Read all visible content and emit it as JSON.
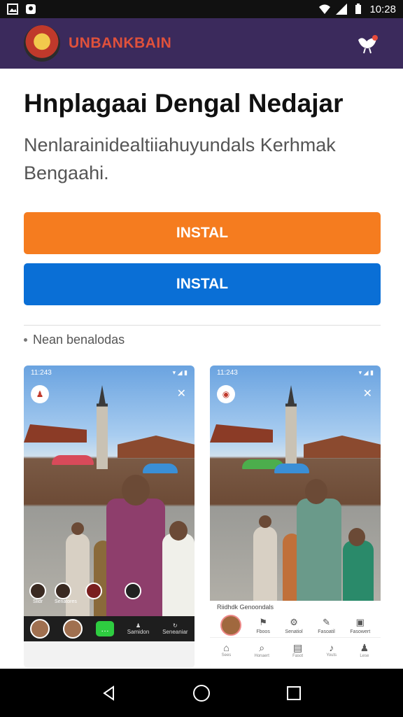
{
  "status_bar": {
    "time": "10:28",
    "notification_icons": [
      "gallery-icon",
      "face-icon"
    ],
    "system_icons": [
      "wifi-icon",
      "signal-icon",
      "battery-icon"
    ]
  },
  "app_bar": {
    "brand": "UNBANKBAIN",
    "logo": "garuda-emblem",
    "action_icon": "hen-icon"
  },
  "main": {
    "headline": "Hnplagaai Dengal Nedajar",
    "description": "Nenlarainidealtiiahuyundals Kerhmak Bengaahi.",
    "install_primary": "INSTAL",
    "install_secondary": "INSTAL",
    "bullet": "Nean benalodas"
  },
  "screenshots": [
    {
      "status_time": "11:243",
      "avatars": [
        "Slidr",
        "Senatores",
        "",
        ""
      ],
      "bottom_labels": [
        "Samidon",
        "Seneaniar"
      ]
    },
    {
      "status_time": "11:243",
      "sheet_title": "Riidhdk Genoondals",
      "actions": [
        "Fboos",
        "Senatiol",
        "Fasoatil",
        "Fasowert"
      ],
      "nav": [
        "Sees",
        "Honaert",
        "Fasot",
        "Youts",
        "Lese"
      ]
    }
  ],
  "nav_bar": {
    "buttons": [
      "back",
      "home",
      "recents"
    ]
  }
}
